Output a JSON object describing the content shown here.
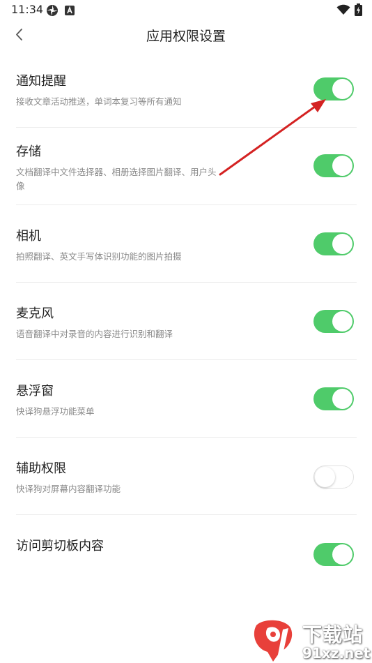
{
  "status_bar": {
    "time": "11:34",
    "icons": [
      "pinwheel-icon",
      "a-badge-icon",
      "wifi-icon",
      "battery-charging-icon"
    ]
  },
  "header": {
    "title": "应用权限设置",
    "back_icon": "chevron-left-icon"
  },
  "permissions": [
    {
      "title": "通知提醒",
      "desc": "接收文章活动推送，单词本复习等所有通知",
      "enabled": true
    },
    {
      "title": "存储",
      "desc": "文档翻译中文件选择器、相册选择图片翻译、用户头像",
      "enabled": true
    },
    {
      "title": "相机",
      "desc": "拍照翻译、英文手写体识别功能的图片拍摄",
      "enabled": true
    },
    {
      "title": "麦克风",
      "desc": "语音翻译中对录音的内容进行识别和翻译",
      "enabled": true
    },
    {
      "title": "悬浮窗",
      "desc": "快译狗悬浮功能菜单",
      "enabled": true
    },
    {
      "title": "辅助权限",
      "desc": "快译狗对屏幕内容翻译功能",
      "enabled": false
    },
    {
      "title": "访问剪切板内容",
      "desc": "",
      "enabled": true
    }
  ],
  "colors": {
    "toggle_on": "#4fcb6a",
    "toggle_off_border": "#e2e2e2",
    "arrow": "#d42222",
    "watermark_logo": "#e8403a"
  },
  "watermark": {
    "top_text": "下载站",
    "bottom_text": "91xz.net"
  }
}
